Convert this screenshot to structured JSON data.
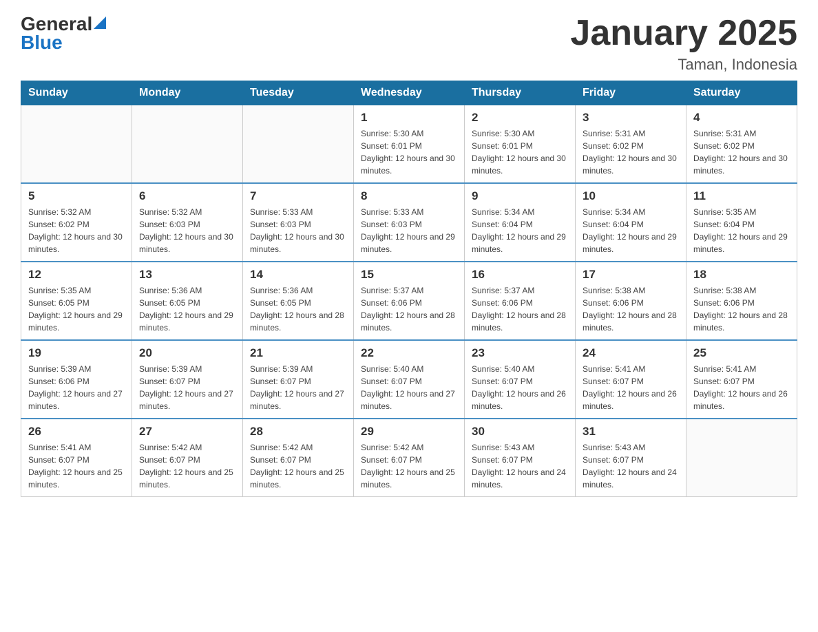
{
  "header": {
    "logo_general": "General",
    "logo_blue": "Blue",
    "title": "January 2025",
    "subtitle": "Taman, Indonesia"
  },
  "days_of_week": [
    "Sunday",
    "Monday",
    "Tuesday",
    "Wednesday",
    "Thursday",
    "Friday",
    "Saturday"
  ],
  "weeks": [
    [
      {
        "day": "",
        "info": ""
      },
      {
        "day": "",
        "info": ""
      },
      {
        "day": "",
        "info": ""
      },
      {
        "day": "1",
        "info": "Sunrise: 5:30 AM\nSunset: 6:01 PM\nDaylight: 12 hours and 30 minutes."
      },
      {
        "day": "2",
        "info": "Sunrise: 5:30 AM\nSunset: 6:01 PM\nDaylight: 12 hours and 30 minutes."
      },
      {
        "day": "3",
        "info": "Sunrise: 5:31 AM\nSunset: 6:02 PM\nDaylight: 12 hours and 30 minutes."
      },
      {
        "day": "4",
        "info": "Sunrise: 5:31 AM\nSunset: 6:02 PM\nDaylight: 12 hours and 30 minutes."
      }
    ],
    [
      {
        "day": "5",
        "info": "Sunrise: 5:32 AM\nSunset: 6:02 PM\nDaylight: 12 hours and 30 minutes."
      },
      {
        "day": "6",
        "info": "Sunrise: 5:32 AM\nSunset: 6:03 PM\nDaylight: 12 hours and 30 minutes."
      },
      {
        "day": "7",
        "info": "Sunrise: 5:33 AM\nSunset: 6:03 PM\nDaylight: 12 hours and 30 minutes."
      },
      {
        "day": "8",
        "info": "Sunrise: 5:33 AM\nSunset: 6:03 PM\nDaylight: 12 hours and 29 minutes."
      },
      {
        "day": "9",
        "info": "Sunrise: 5:34 AM\nSunset: 6:04 PM\nDaylight: 12 hours and 29 minutes."
      },
      {
        "day": "10",
        "info": "Sunrise: 5:34 AM\nSunset: 6:04 PM\nDaylight: 12 hours and 29 minutes."
      },
      {
        "day": "11",
        "info": "Sunrise: 5:35 AM\nSunset: 6:04 PM\nDaylight: 12 hours and 29 minutes."
      }
    ],
    [
      {
        "day": "12",
        "info": "Sunrise: 5:35 AM\nSunset: 6:05 PM\nDaylight: 12 hours and 29 minutes."
      },
      {
        "day": "13",
        "info": "Sunrise: 5:36 AM\nSunset: 6:05 PM\nDaylight: 12 hours and 29 minutes."
      },
      {
        "day": "14",
        "info": "Sunrise: 5:36 AM\nSunset: 6:05 PM\nDaylight: 12 hours and 28 minutes."
      },
      {
        "day": "15",
        "info": "Sunrise: 5:37 AM\nSunset: 6:06 PM\nDaylight: 12 hours and 28 minutes."
      },
      {
        "day": "16",
        "info": "Sunrise: 5:37 AM\nSunset: 6:06 PM\nDaylight: 12 hours and 28 minutes."
      },
      {
        "day": "17",
        "info": "Sunrise: 5:38 AM\nSunset: 6:06 PM\nDaylight: 12 hours and 28 minutes."
      },
      {
        "day": "18",
        "info": "Sunrise: 5:38 AM\nSunset: 6:06 PM\nDaylight: 12 hours and 28 minutes."
      }
    ],
    [
      {
        "day": "19",
        "info": "Sunrise: 5:39 AM\nSunset: 6:06 PM\nDaylight: 12 hours and 27 minutes."
      },
      {
        "day": "20",
        "info": "Sunrise: 5:39 AM\nSunset: 6:07 PM\nDaylight: 12 hours and 27 minutes."
      },
      {
        "day": "21",
        "info": "Sunrise: 5:39 AM\nSunset: 6:07 PM\nDaylight: 12 hours and 27 minutes."
      },
      {
        "day": "22",
        "info": "Sunrise: 5:40 AM\nSunset: 6:07 PM\nDaylight: 12 hours and 27 minutes."
      },
      {
        "day": "23",
        "info": "Sunrise: 5:40 AM\nSunset: 6:07 PM\nDaylight: 12 hours and 26 minutes."
      },
      {
        "day": "24",
        "info": "Sunrise: 5:41 AM\nSunset: 6:07 PM\nDaylight: 12 hours and 26 minutes."
      },
      {
        "day": "25",
        "info": "Sunrise: 5:41 AM\nSunset: 6:07 PM\nDaylight: 12 hours and 26 minutes."
      }
    ],
    [
      {
        "day": "26",
        "info": "Sunrise: 5:41 AM\nSunset: 6:07 PM\nDaylight: 12 hours and 25 minutes."
      },
      {
        "day": "27",
        "info": "Sunrise: 5:42 AM\nSunset: 6:07 PM\nDaylight: 12 hours and 25 minutes."
      },
      {
        "day": "28",
        "info": "Sunrise: 5:42 AM\nSunset: 6:07 PM\nDaylight: 12 hours and 25 minutes."
      },
      {
        "day": "29",
        "info": "Sunrise: 5:42 AM\nSunset: 6:07 PM\nDaylight: 12 hours and 25 minutes."
      },
      {
        "day": "30",
        "info": "Sunrise: 5:43 AM\nSunset: 6:07 PM\nDaylight: 12 hours and 24 minutes."
      },
      {
        "day": "31",
        "info": "Sunrise: 5:43 AM\nSunset: 6:07 PM\nDaylight: 12 hours and 24 minutes."
      },
      {
        "day": "",
        "info": ""
      }
    ]
  ]
}
